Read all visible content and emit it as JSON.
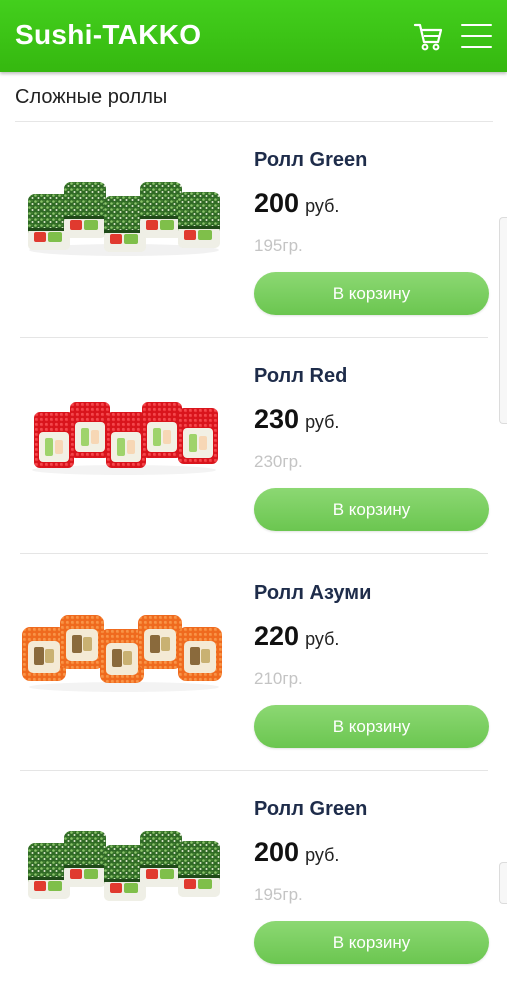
{
  "header": {
    "brand": "Sushi-TAKKO",
    "cart_icon": "cart-icon",
    "menu_icon": "hamburger-menu-icon"
  },
  "category": {
    "title": "Сложные роллы"
  },
  "colors": {
    "header_green": "#3cc516",
    "button_green": "#7bcf60",
    "product_name": "#1e2c4a",
    "weight_gray": "#c4c4c4"
  },
  "products": [
    {
      "name": "Ролл Green",
      "price": "200",
      "currency": "руб.",
      "weight": "195гр.",
      "button": "В корзину",
      "image": "green-roll-image"
    },
    {
      "name": "Ролл Red",
      "price": "230",
      "currency": "руб.",
      "weight": "230гр.",
      "button": "В корзину",
      "image": "red-roll-image"
    },
    {
      "name": "Ролл Азуми",
      "price": "220",
      "currency": "руб.",
      "weight": "210гр.",
      "button": "В корзину",
      "image": "orange-roll-image"
    },
    {
      "name": "Ролл Green",
      "price": "200",
      "currency": "руб.",
      "weight": "195гр.",
      "button": "В корзину",
      "image": "green-roll-image"
    }
  ]
}
